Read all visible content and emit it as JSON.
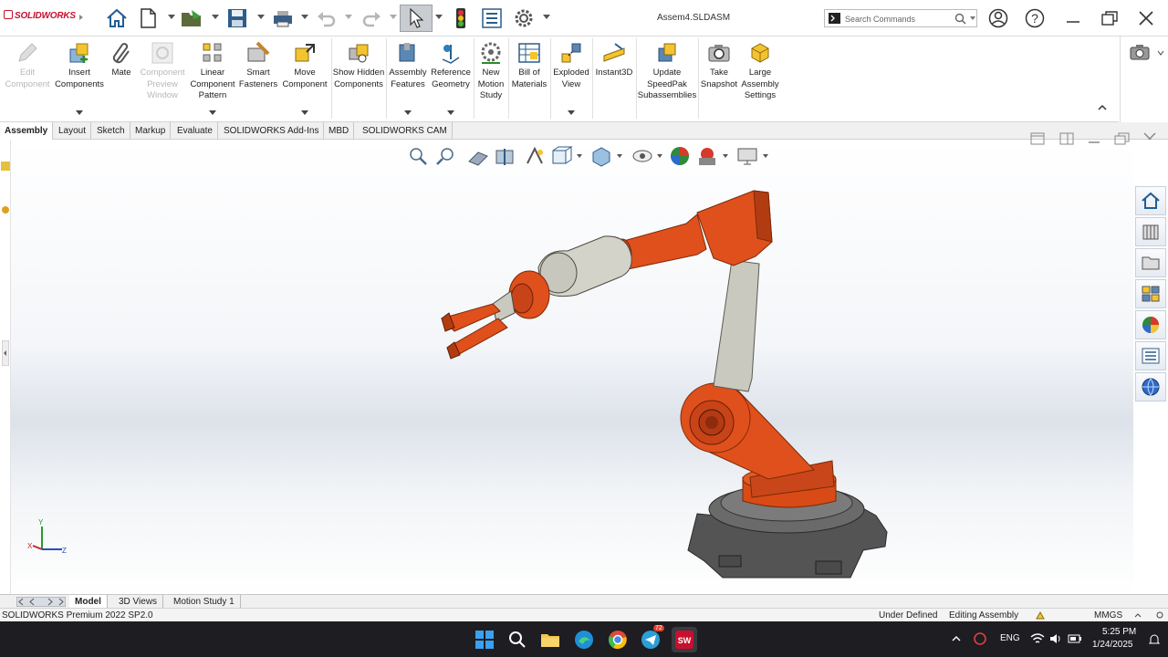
{
  "app": {
    "logo": "SOLIDWORKS",
    "document_title": "Assem4.SLDASM",
    "search_placeholder": "Search Commands"
  },
  "ribbon": {
    "buttons": [
      {
        "label": "Edit Component",
        "enabled": false,
        "icon": "edit-component-icon"
      },
      {
        "label": "Insert Components",
        "enabled": true,
        "icon": "insert-components-icon",
        "has_dropdown": true
      },
      {
        "label": "Mate",
        "enabled": true,
        "icon": "mate-paperclip-icon"
      },
      {
        "label": "Component Preview Window",
        "enabled": false,
        "icon": "component-preview-icon"
      },
      {
        "label": "Linear Component Pattern",
        "enabled": true,
        "icon": "linear-pattern-icon",
        "has_dropdown": true
      },
      {
        "label": "Smart Fasteners",
        "enabled": true,
        "icon": "smart-fasteners-icon"
      },
      {
        "label": "Move Component",
        "enabled": true,
        "icon": "move-component-icon",
        "has_dropdown": true
      },
      {
        "label": "Show Hidden Components",
        "enabled": true,
        "icon": "show-hidden-icon"
      },
      {
        "label": "Assembly Features",
        "enabled": true,
        "icon": "assembly-features-icon",
        "has_dropdown": true
      },
      {
        "label": "Reference Geometry",
        "enabled": true,
        "icon": "reference-geometry-icon",
        "has_dropdown": true
      },
      {
        "label": "New Motion Study",
        "enabled": true,
        "icon": "motion-study-icon"
      },
      {
        "label": "Bill of Materials",
        "enabled": true,
        "icon": "bill-of-materials-icon"
      },
      {
        "label": "Exploded View",
        "enabled": true,
        "icon": "exploded-view-icon",
        "has_dropdown": true
      },
      {
        "label": "Instant3D",
        "enabled": true,
        "icon": "instant3d-icon"
      },
      {
        "label": "Update SpeedPak Subassemblies",
        "enabled": true,
        "icon": "speedpak-icon"
      },
      {
        "label": "Take Snapshot",
        "enabled": true,
        "icon": "snapshot-camera-icon"
      },
      {
        "label": "Large Assembly Settings",
        "enabled": true,
        "icon": "large-assembly-icon"
      }
    ]
  },
  "command_tabs": [
    "Assembly",
    "Layout",
    "Sketch",
    "Markup",
    "Evaluate",
    "SOLIDWORKS Add-Ins",
    "MBD",
    "SOLIDWORKS CAM"
  ],
  "active_command_tab": "Assembly",
  "bottom_tabs": [
    "Model",
    "3D Views",
    "Motion Study 1"
  ],
  "active_bottom_tab": "Model",
  "status": {
    "product": "SOLIDWORKS Premium 2022 SP2.0",
    "definition": "Under Defined",
    "mode": "Editing Assembly",
    "units": "MMGS"
  },
  "taskbar": {
    "badge_count": "72",
    "language": "ENG",
    "time": "5:25 PM",
    "date": "1/24/2025"
  },
  "colors": {
    "robot_orange": "#e0501c",
    "robot_grey": "#c9c9c0",
    "base_dark": "#5a5a5a",
    "accent_red": "#c8102e"
  }
}
